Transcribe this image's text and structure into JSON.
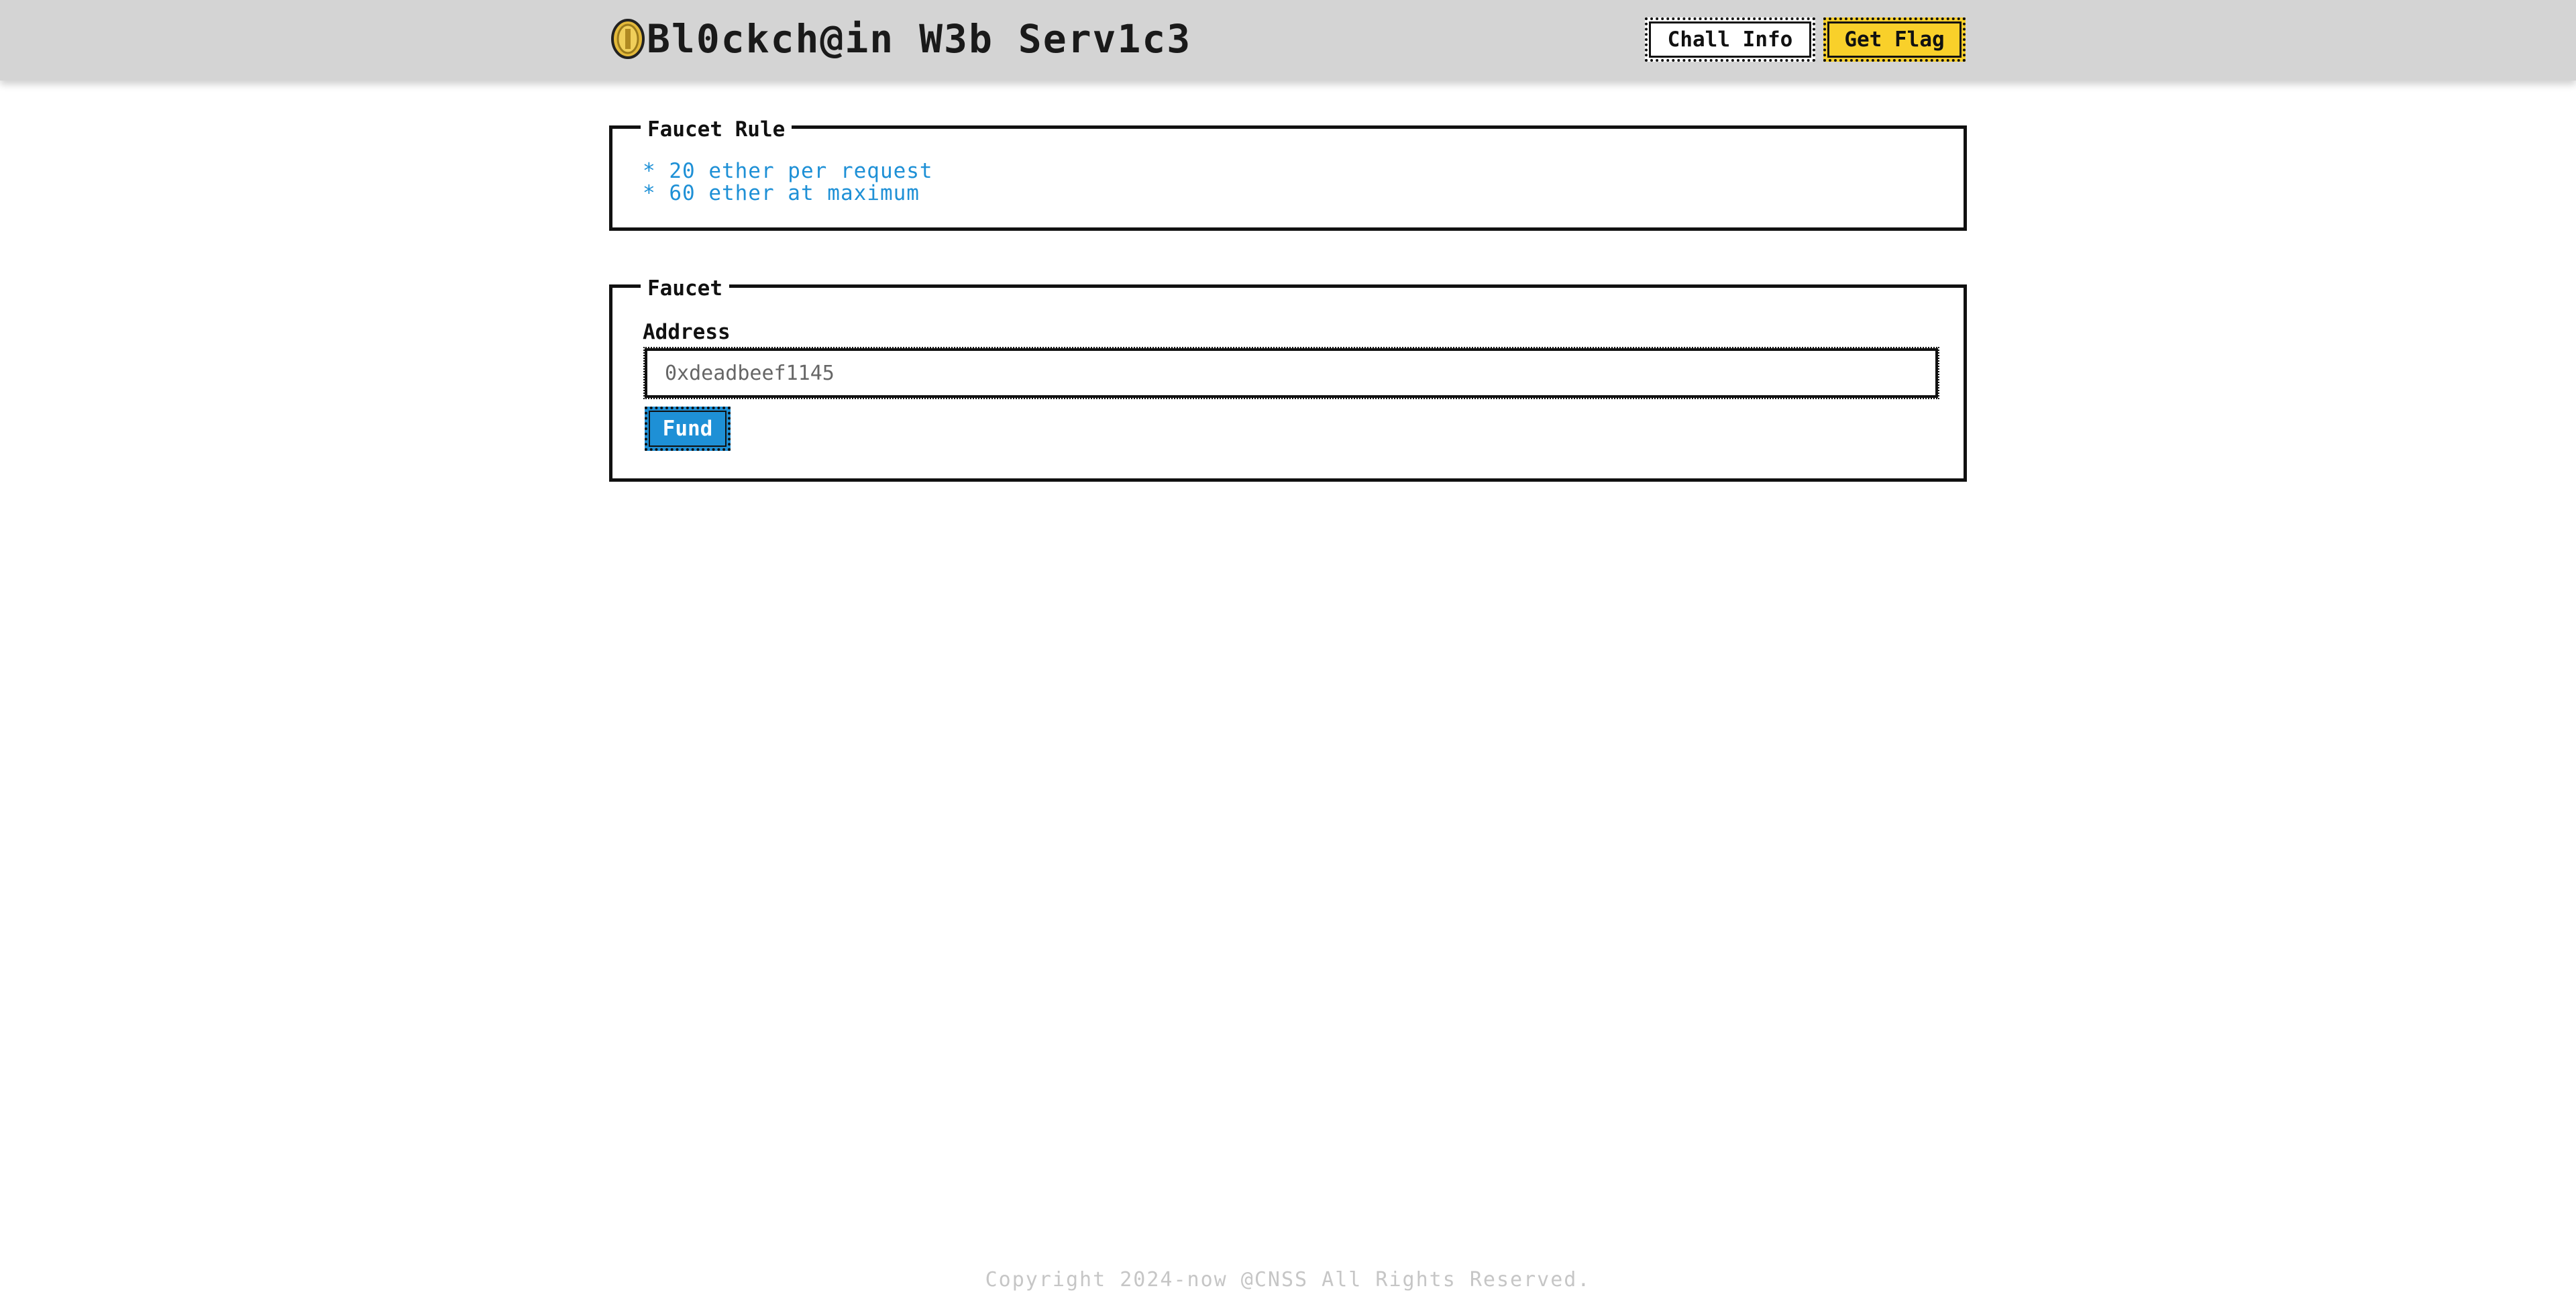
{
  "header": {
    "title": "Bl0ckch@in W3b Serv1c3",
    "logo_icon": "coin-icon",
    "chall_info_label": "Chall Info",
    "get_flag_label": "Get Flag"
  },
  "rules": {
    "legend": "Faucet Rule",
    "lines": [
      "* 20 ether per request",
      "* 60 ether at maximum"
    ]
  },
  "faucet": {
    "legend": "Faucet",
    "address_label": "Address",
    "address_placeholder": "0xdeadbeef1145",
    "address_value": "",
    "fund_label": "Fund"
  },
  "footer": {
    "copyright": "Copyright 2024-now @CNSS All Rights Reserved."
  },
  "colors": {
    "header_bg": "#d4d4d4",
    "flag_button": "#f9d02a",
    "accent_blue": "#1e90d6"
  }
}
